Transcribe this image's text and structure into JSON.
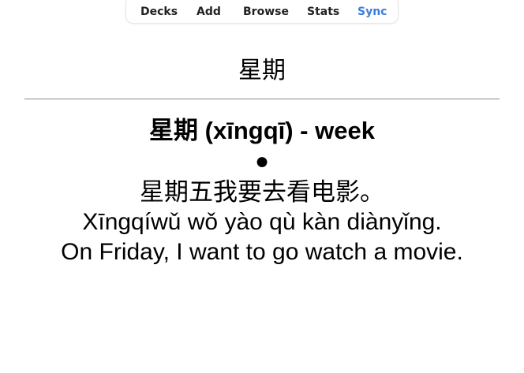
{
  "toolbar": {
    "items": [
      {
        "label": "Decks",
        "active": false
      },
      {
        "label": "Add",
        "active": false
      },
      {
        "label": "Browse",
        "active": false
      },
      {
        "label": "Stats",
        "active": false
      },
      {
        "label": "Sync",
        "active": true
      }
    ],
    "active_color": "#3b7ddd"
  },
  "card": {
    "front": "星期",
    "heading": "星期 (xīngqī) - week",
    "bullet": "●",
    "sentence_hanzi": "星期五我要去看电影。",
    "sentence_pinyin": "Xīngqíwǔ wǒ yào qù kàn diànyǐng.",
    "sentence_english": "On Friday, I want to go watch a movie."
  }
}
